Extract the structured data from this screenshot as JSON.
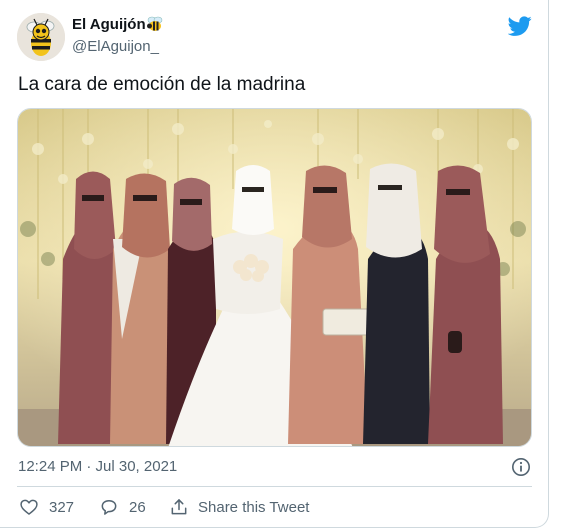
{
  "author": {
    "name": "El Aguijón",
    "handle": "@ElAguijon_",
    "name_emoji_icon": "bee-icon"
  },
  "tweet": {
    "text": "La cara de emoción de la madrina",
    "timestamp": "12:24 PM · Jul 30, 2021"
  },
  "actions": {
    "like_count": "327",
    "reply_count": "26",
    "share_label": "Share this Tweet"
  },
  "colors": {
    "twitter_blue": "#1d9bf0",
    "text_primary": "#0f1419",
    "text_secondary": "#536471",
    "border": "#cfd9de"
  },
  "icons": [
    "twitter-logo-icon",
    "info-icon",
    "heart-icon",
    "reply-bubble-icon",
    "share-icon"
  ]
}
